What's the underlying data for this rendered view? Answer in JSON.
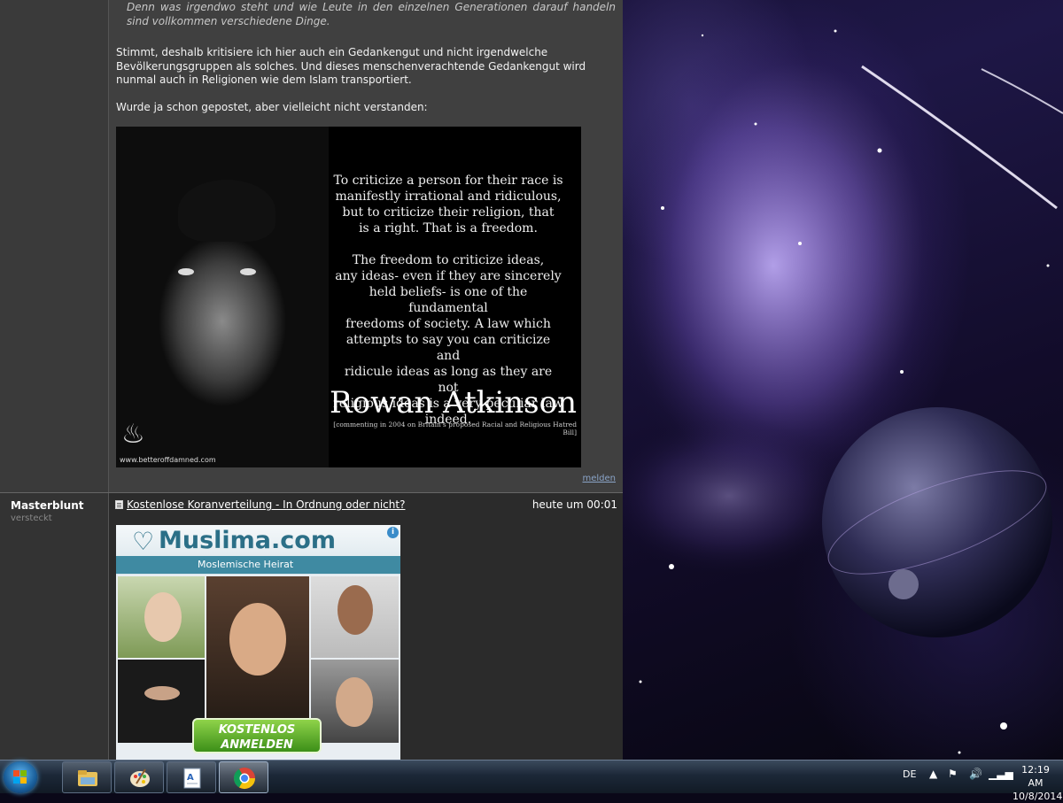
{
  "post1": {
    "quote": "Denn was irgendwo steht und wie Leute in den einzelnen Generationen darauf handeln sind vollkommen verschiedene Dinge.",
    "para1": "Stimmt, deshalb kritisiere ich hier auch ein Gedankengut und nicht irgendwelche Bevölkerungsgruppen als solches. Und dieses menschenverachtende Gedankengut wird nunmal auch in Religionen wie dem Islam transportiert.",
    "para2": "Wurde ja schon gepostet, aber vielleicht nicht verstanden:",
    "meme": {
      "text": "To criticize a person for their race is\nmanifestly irrational and ridiculous,\nbut to criticize their religion, that\nis a right. That is a freedom.\n\nThe freedom to criticize ideas,\nany ideas- even if they are sincerely\nheld beliefs- is one of the fundamental\nfreedoms of society. A law which\nattempts to say you can criticize and\nridicule ideas as long as they are not\nreligious ideas is a very peculiar law indeed.",
      "name": "Rowan Atkinson",
      "subtitle": "[commenting in 2004 on Britain's proposed Racial and Religious Hatred Bill]",
      "url": "www.betteroffdamned.com"
    },
    "report": "melden"
  },
  "post2": {
    "author": "Masterblunt",
    "status": "versteckt",
    "subject": "Kostenlose Koranverteilung - In Ordnung oder nicht?",
    "time": "heute um 00:01",
    "ad": {
      "brand": "Muslima.com",
      "tagline": "Moslemische Heirat",
      "button_line1": "KOSTENLOS",
      "button_line2": "ANMELDEN",
      "info": "i"
    }
  },
  "taskbar": {
    "apps": [
      {
        "name": "explorer",
        "icon": "folder-icon"
      },
      {
        "name": "paint",
        "icon": "paint-palette-icon"
      },
      {
        "name": "wordpad",
        "icon": "document-icon"
      },
      {
        "name": "chrome",
        "icon": "chrome-icon"
      }
    ],
    "language": "DE",
    "time": "12:19 AM",
    "date": "10/8/2014"
  },
  "colors": {
    "accent": "#3f8aa2",
    "brand": "#2b6f87",
    "link": "#8aa4c8"
  }
}
